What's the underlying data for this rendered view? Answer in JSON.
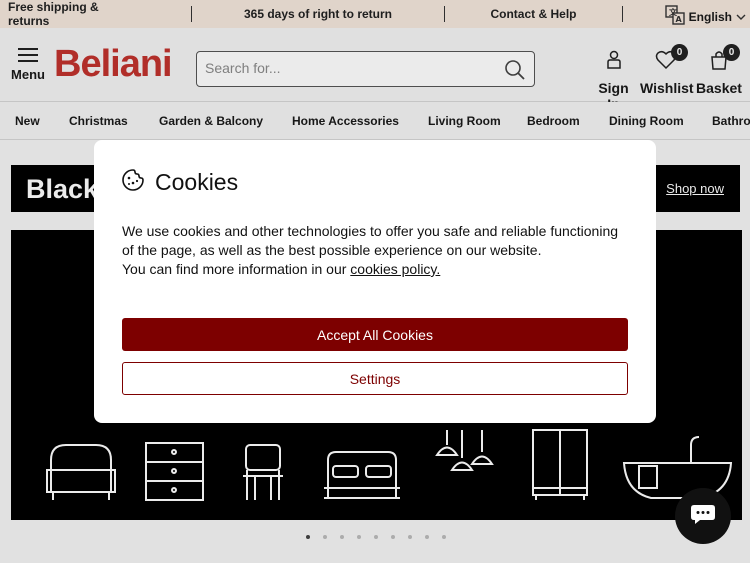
{
  "topbar": {
    "shipping": "Free shipping & returns",
    "return": "365 days of right to return",
    "contact": "Contact & Help",
    "language": "English"
  },
  "header": {
    "menu_label": "Menu",
    "logo": "Beliani",
    "search_placeholder": "Search for...",
    "sign_in": "Sign In",
    "wishlist": "Wishlist",
    "wishlist_count": "0",
    "basket": "Basket",
    "basket_count": "0"
  },
  "nav": {
    "items": [
      "New",
      "Christmas",
      "Garden & Balcony",
      "Home Accessories",
      "Living Room",
      "Bedroom",
      "Dining Room",
      "Bathro"
    ]
  },
  "promo": {
    "title": "Black",
    "shop_now": "Shop now"
  },
  "cookies": {
    "title": "Cookies",
    "text": "We use cookies and other technologies to offer you safe and reliable functioning of the page, as well as the best possible experience on our website.",
    "more_prefix": "You can find more information in our ",
    "policy_link": "cookies policy.",
    "accept_label": "Accept All Cookies",
    "settings_label": "Settings"
  },
  "colors": {
    "brand": "#c0322d",
    "accept_button": "#7d0000",
    "topbar_bg": "#f3e6dc"
  },
  "carousel": {
    "slides": 9,
    "active": 1
  }
}
